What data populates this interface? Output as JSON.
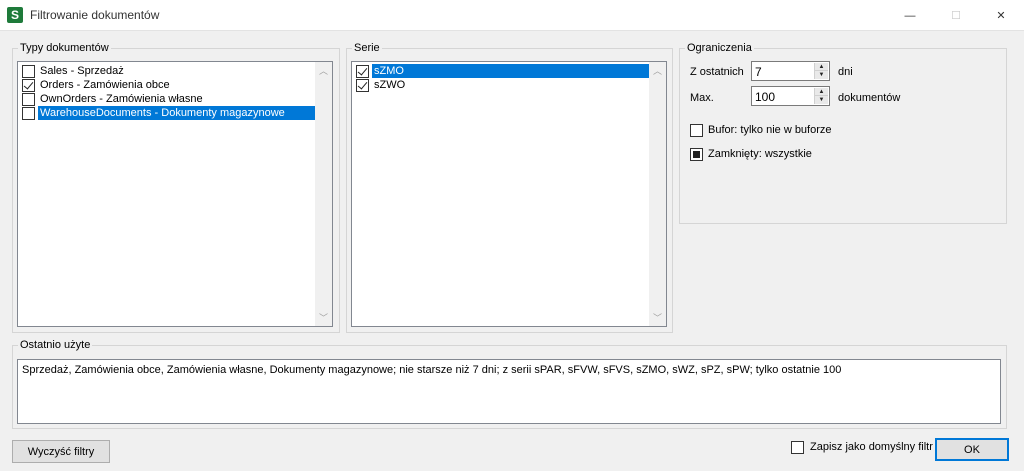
{
  "window": {
    "title": "Filtrowanie dokumentów",
    "icon_letter": "S",
    "minimize_glyph": "—",
    "maximize_glyph": "☐",
    "close_glyph": "✕"
  },
  "doc_types": {
    "legend": "Typy dokumentów",
    "items": [
      {
        "label": "Sales - Sprzedaż",
        "checked": false,
        "selected": false
      },
      {
        "label": "Orders - Zamówienia obce",
        "checked": true,
        "selected": false
      },
      {
        "label": "OwnOrders - Zamówienia własne",
        "checked": false,
        "selected": false
      },
      {
        "label": "WarehouseDocuments - Dokumenty magazynowe",
        "checked": false,
        "selected": true
      }
    ]
  },
  "series": {
    "legend": "Serie",
    "items": [
      {
        "label": "sZMO",
        "checked": true,
        "selected": true
      },
      {
        "label": "sZWO",
        "checked": true,
        "selected": false
      }
    ]
  },
  "limits": {
    "legend": "Ograniczenia",
    "last_label": "Z ostatnich",
    "last_value": "7",
    "last_unit": "dni",
    "max_label": "Max.",
    "max_value": "100",
    "max_unit": "dokumentów",
    "buffer_label": "Bufor: tylko nie w buforze",
    "buffer_checked": false,
    "closed_label": "Zamknięty: wszystkie",
    "closed_state": "indeterminate"
  },
  "recent": {
    "legend": "Ostatnio użyte",
    "text": "Sprzedaż, Zamówienia obce, Zamówienia własne, Dokumenty magazynowe; nie starsze niż 7 dni; z serii sPAR, sFVW, sFVS, sZMO, sWZ, sPZ, sPW; tylko ostatnie 100"
  },
  "footer": {
    "clear_button": "Wyczyść filtry",
    "save_default_label": "Zapisz jako domyślny filtr",
    "save_default_checked": false,
    "ok_button": "OK"
  },
  "colors": {
    "selection": "#0078d7",
    "app_icon": "#1e7a3a"
  }
}
